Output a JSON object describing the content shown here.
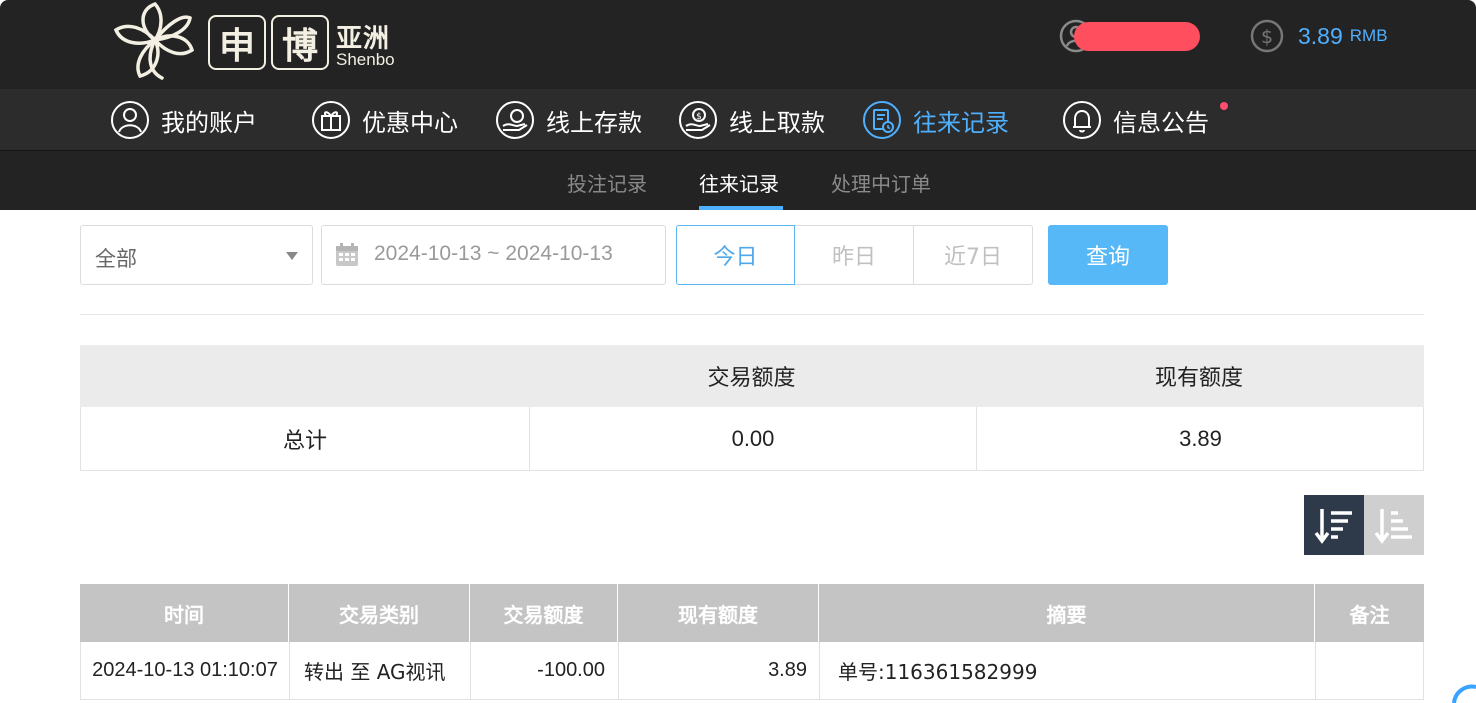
{
  "brand": {
    "logo_char_1": "申",
    "logo_char_2": "博",
    "logo_cn": "亚洲",
    "logo_en": "Shenbo"
  },
  "account": {
    "balance": "3.89",
    "currency": "RMB"
  },
  "nav": {
    "items": [
      {
        "label": "我的账户",
        "icon": "user-icon"
      },
      {
        "label": "优惠中心",
        "icon": "gift-icon"
      },
      {
        "label": "线上存款",
        "icon": "deposit-icon"
      },
      {
        "label": "线上取款",
        "icon": "withdraw-icon"
      },
      {
        "label": "往来记录",
        "icon": "records-icon",
        "active": true
      },
      {
        "label": "信息公告",
        "icon": "bell-icon",
        "badge_dot": true
      }
    ]
  },
  "subnav": {
    "items": [
      "投注记录",
      "往来记录",
      "处理中订单"
    ],
    "active_index": 1
  },
  "filters": {
    "type_select": "全部",
    "date_range": "2024-10-13 ~ 2024-10-13",
    "quick_today": "今日",
    "quick_yesterday": "昨日",
    "quick_week": "近7日",
    "search_label": "查询"
  },
  "summary": {
    "headers": [
      "",
      "交易额度",
      "现有额度"
    ],
    "row": {
      "label": "总计",
      "amount": "0.00",
      "balance": "3.89"
    }
  },
  "records": {
    "headers": [
      "时间",
      "交易类别",
      "交易额度",
      "现有额度",
      "摘要",
      "备注"
    ],
    "rows": [
      {
        "time": "2024-10-13 01:10:07",
        "type": "转出 至 AG视讯",
        "amount": "-100.00",
        "balance": "3.89",
        "summary": "单号:116361582999",
        "note": ""
      }
    ]
  },
  "colors": {
    "accent": "#4fb0ff",
    "header_bg": "#232323",
    "nav_bg": "#2c2c2c",
    "search_button": "#57b8f7",
    "redaction": "#ff4e5e"
  }
}
